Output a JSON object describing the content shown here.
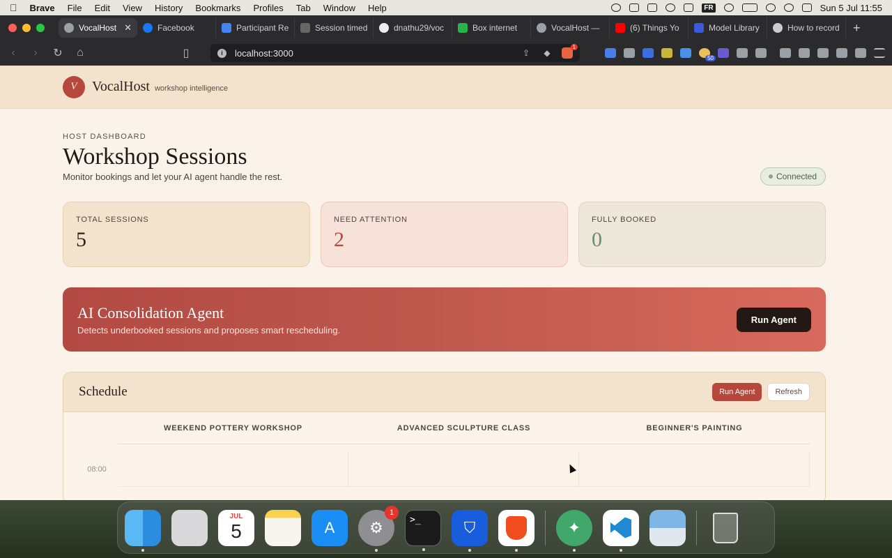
{
  "menubar": {
    "app": "Brave",
    "items": [
      "File",
      "Edit",
      "View",
      "History",
      "Bookmarks",
      "Profiles",
      "Tab",
      "Window",
      "Help"
    ],
    "input_source": "FR",
    "clock": "Sun 5 Jul  11:55"
  },
  "browser": {
    "tabs": [
      {
        "label": "VocalHost",
        "active": true
      },
      {
        "label": "Facebook"
      },
      {
        "label": "Participant Re"
      },
      {
        "label": "Session timed"
      },
      {
        "label": "dnathu29/voc"
      },
      {
        "label": "Box internet"
      },
      {
        "label": "VocalHost —"
      },
      {
        "label": "(6) Things Yo"
      },
      {
        "label": "Model Library"
      },
      {
        "label": "How to record"
      }
    ],
    "url": "localhost:3000",
    "shield_count": "1",
    "ext_badge": "50"
  },
  "app": {
    "logo_letter": "V",
    "brand": "VocalHost",
    "tagline": "workshop intelligence",
    "kicker": "HOST DASHBOARD",
    "title": "Workshop Sessions",
    "subtitle": "Monitor bookings and let your AI agent handle the rest.",
    "status": "Connected",
    "stats": [
      {
        "label": "TOTAL SESSIONS",
        "value": "5"
      },
      {
        "label": "NEED ATTENTION",
        "value": "2"
      },
      {
        "label": "FULLY BOOKED",
        "value": "0"
      }
    ],
    "agent": {
      "title": "AI Consolidation Agent",
      "description": "Detects underbooked sessions and proposes smart rescheduling.",
      "button": "Run Agent"
    },
    "schedule": {
      "title": "Schedule",
      "run_button": "Run Agent",
      "refresh_button": "Refresh",
      "columns": [
        "WEEKEND POTTERY WORKSHOP",
        "ADVANCED SCULPTURE CLASS",
        "BEGINNER'S PAINTING"
      ],
      "times": [
        "08:00"
      ]
    }
  },
  "dock": {
    "calendar_month": "JUL",
    "calendar_day": "5",
    "settings_badge": "1",
    "terminal_prompt": ">_"
  }
}
